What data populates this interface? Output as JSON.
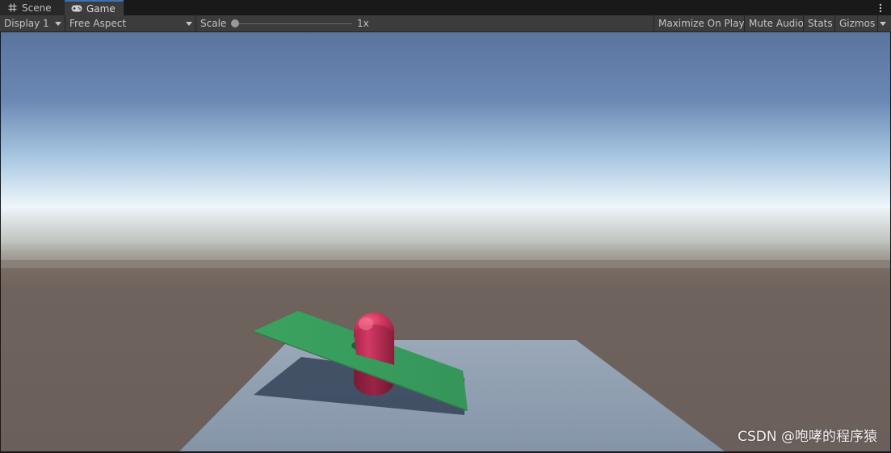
{
  "tabs": [
    {
      "label": "Scene",
      "icon": "grid-icon",
      "active": false
    },
    {
      "label": "Game",
      "icon": "gamepad-icon",
      "active": true
    }
  ],
  "tab_menu_icon": "kebab-menu-icon",
  "toolbar": {
    "display": "Display 1",
    "aspect": "Free Aspect",
    "scale_label": "Scale",
    "scale_value": "1x",
    "maximize": "Maximize On Play",
    "mute": "Mute Audio",
    "stats": "Stats",
    "gizmos": "Gizmos"
  },
  "scene": {
    "objects": [
      "sky",
      "ground",
      "floor-plane",
      "green-tilted-plane",
      "pink-capsule"
    ],
    "colors": {
      "sky_top": "#5a749e",
      "horizon": "#eef6fb",
      "ground": "#6d625c",
      "floor": "#8d9caf",
      "green_plane": "#3a9a5b",
      "capsule": "#c8335a"
    }
  },
  "watermark": "CSDN @咆哮的程序猿"
}
